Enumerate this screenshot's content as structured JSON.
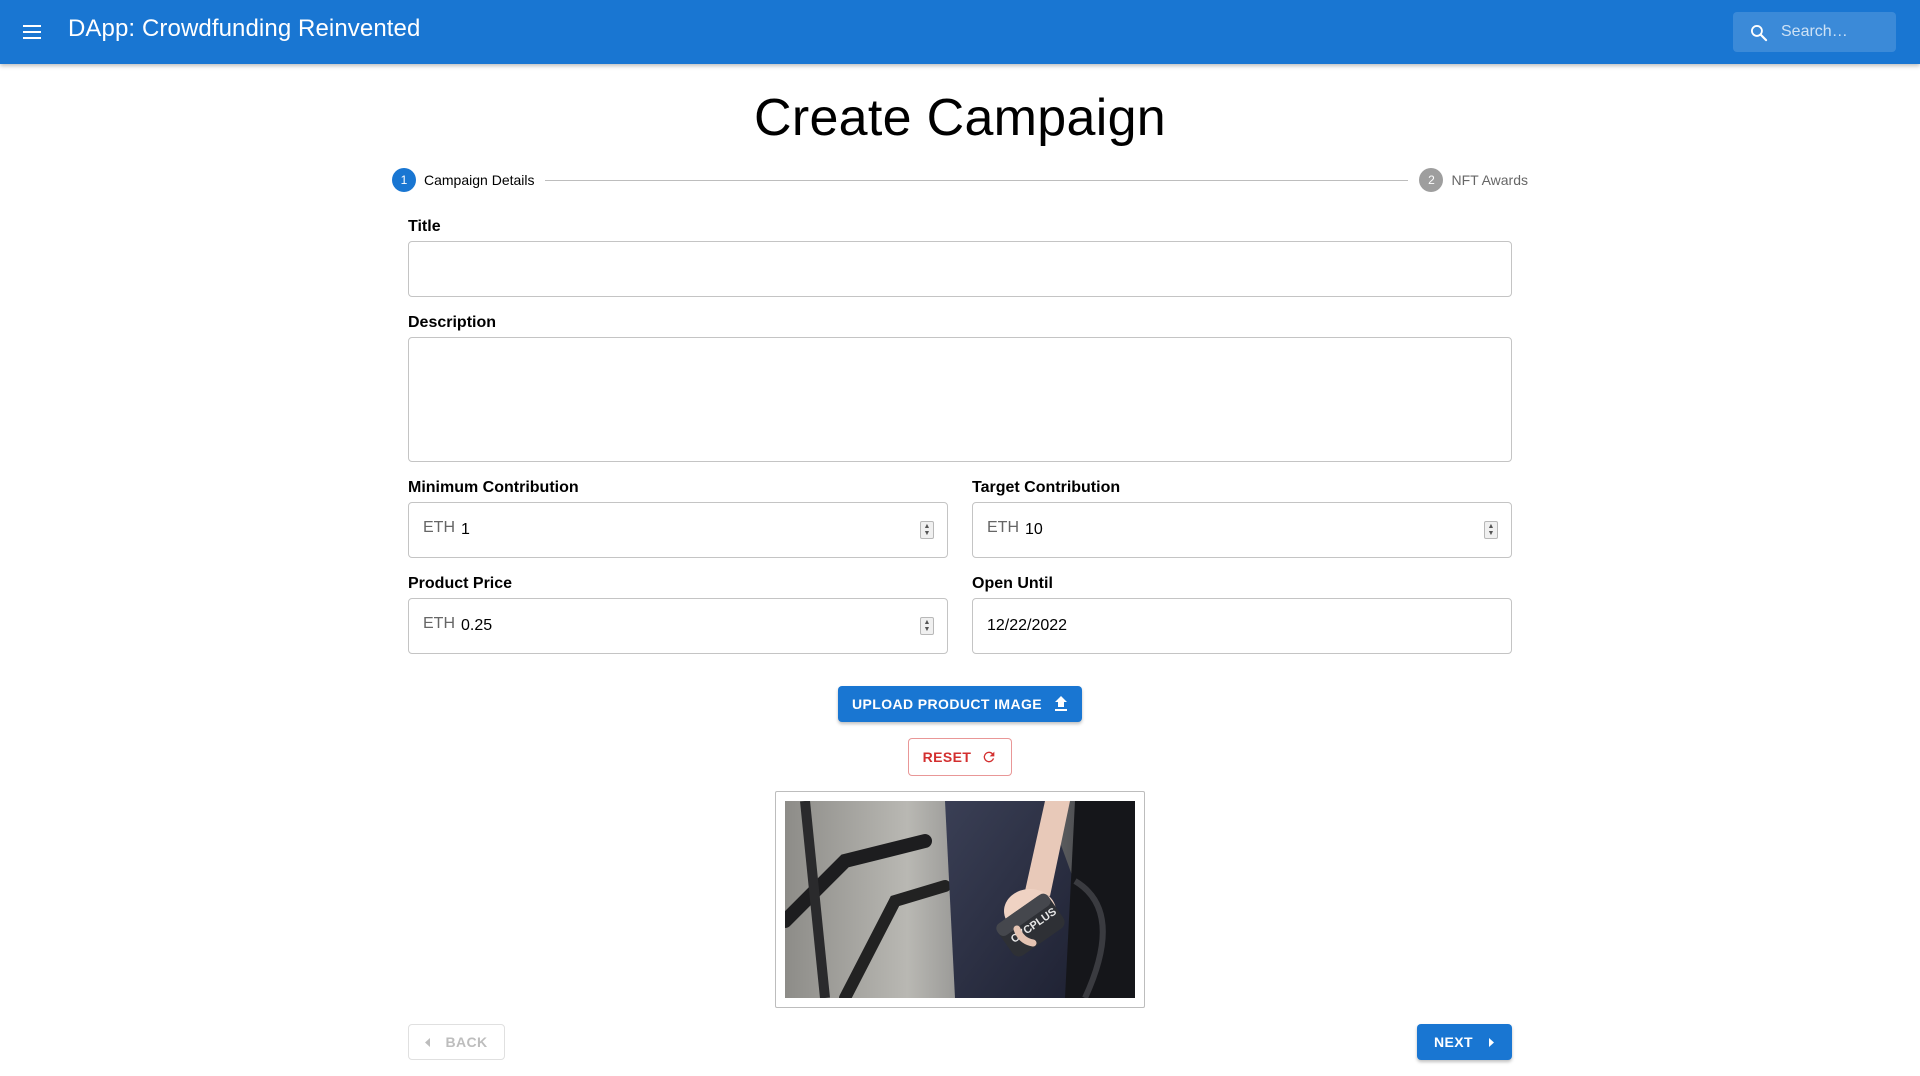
{
  "appbar": {
    "title": "DApp: Crowdfunding Reinvented",
    "search_placeholder": "Search…",
    "menu_icon": "menu-icon",
    "search_icon": "search-icon",
    "color": "#1976d2"
  },
  "page": {
    "title": "Create Campaign"
  },
  "stepper": {
    "steps": [
      {
        "number": "1",
        "label": "Campaign Details",
        "state": "active"
      },
      {
        "number": "2",
        "label": "NFT Awards",
        "state": "inactive"
      }
    ]
  },
  "form": {
    "title": {
      "label": "Title",
      "value": ""
    },
    "description": {
      "label": "Description",
      "value": ""
    },
    "min_contribution": {
      "label": "Minimum Contribution",
      "unit": "ETH",
      "value": "1"
    },
    "target_contribution": {
      "label": "Target Contribution",
      "unit": "ETH",
      "value": "10"
    },
    "product_price": {
      "label": "Product Price",
      "unit": "ETH",
      "value": "0.25"
    },
    "open_until": {
      "label": "Open Until",
      "value": "12/22/2022"
    }
  },
  "buttons": {
    "upload": "UPLOAD PRODUCT IMAGE",
    "reset": "RESET",
    "back": "BACK",
    "next": "NEXT"
  },
  "preview": {
    "brand_text": "CYCPLUS"
  },
  "colors": {
    "primary": "#1976d2",
    "error": "#d32f2f",
    "disabled": "#bdbdbd"
  }
}
